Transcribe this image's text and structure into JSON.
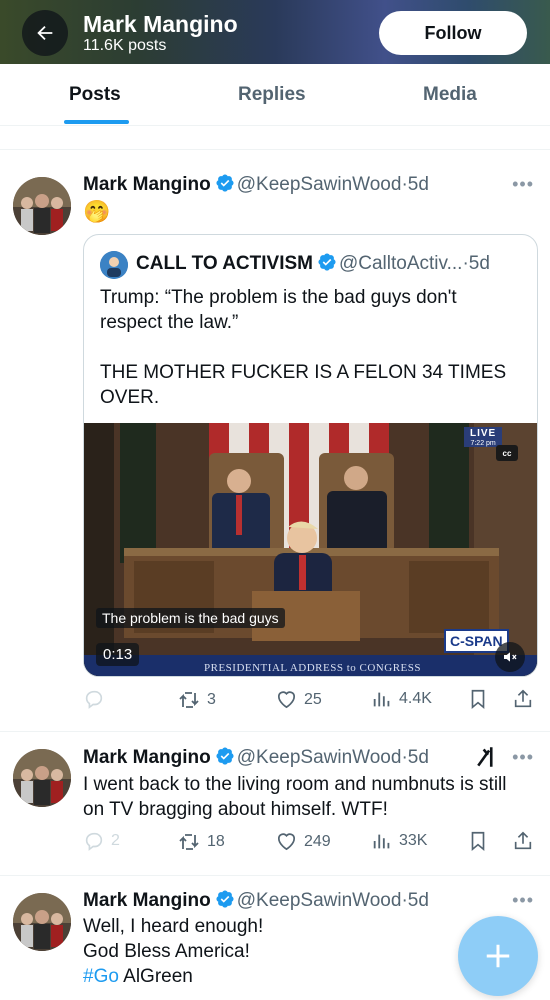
{
  "header": {
    "name": "Mark Mangino",
    "posts_count": "11.6K posts",
    "follow_label": "Follow"
  },
  "tabs": [
    {
      "label": "Posts",
      "active": true
    },
    {
      "label": "Replies",
      "active": false
    },
    {
      "label": "Media",
      "active": false
    }
  ],
  "tweets": [
    {
      "name": "Mark Mangino",
      "handle": "@KeepSawinWood",
      "time": "5d",
      "text": "🤭",
      "quote": {
        "name": "CALL TO ACTIVISM",
        "handle": "@CalltoActiv...",
        "time": "5d",
        "text_line1": "Trump: “The problem is the bad guys don't respect the law.”",
        "text_line2": "THE MOTHER FUCKER IS A FELON 34 TIMES OVER.",
        "video": {
          "live_label": "LIVE",
          "live_time": "7:22 pm",
          "cc_label": "cc",
          "caption": "The problem is the bad guys",
          "duration": "0:13",
          "network": "C-SPAN",
          "banner": "PRESIDENTIAL ADDRESS to CONGRESS"
        }
      },
      "actions": {
        "replies": "",
        "reposts": "3",
        "likes": "25",
        "views": "4.4K"
      }
    },
    {
      "name": "Mark Mangino",
      "handle": "@KeepSawinWood",
      "time": "5d",
      "text": "I went back to the living room and numbnuts is still on TV bragging about himself. WTF!",
      "actions": {
        "replies": "2",
        "reposts": "18",
        "likes": "249",
        "views": "33K"
      }
    },
    {
      "name": "Mark Mangino",
      "handle": "@KeepSawinWood",
      "time": "5d",
      "text_line1": "Well, I heard enough!",
      "text_line2": "God Bless America!",
      "hashtag": "#Go",
      "text_tail": " AlGreen"
    }
  ],
  "colors": {
    "accent": "#1d9bf0",
    "text": "#0f1419",
    "secondary": "#536471",
    "fab": "#8ecdf7"
  },
  "icons": [
    "back-arrow-icon",
    "verified-badge-icon",
    "more-icon",
    "reply-icon",
    "repost-icon",
    "like-icon",
    "views-icon",
    "bookmark-icon",
    "share-icon",
    "grok-icon",
    "compose-icon"
  ]
}
